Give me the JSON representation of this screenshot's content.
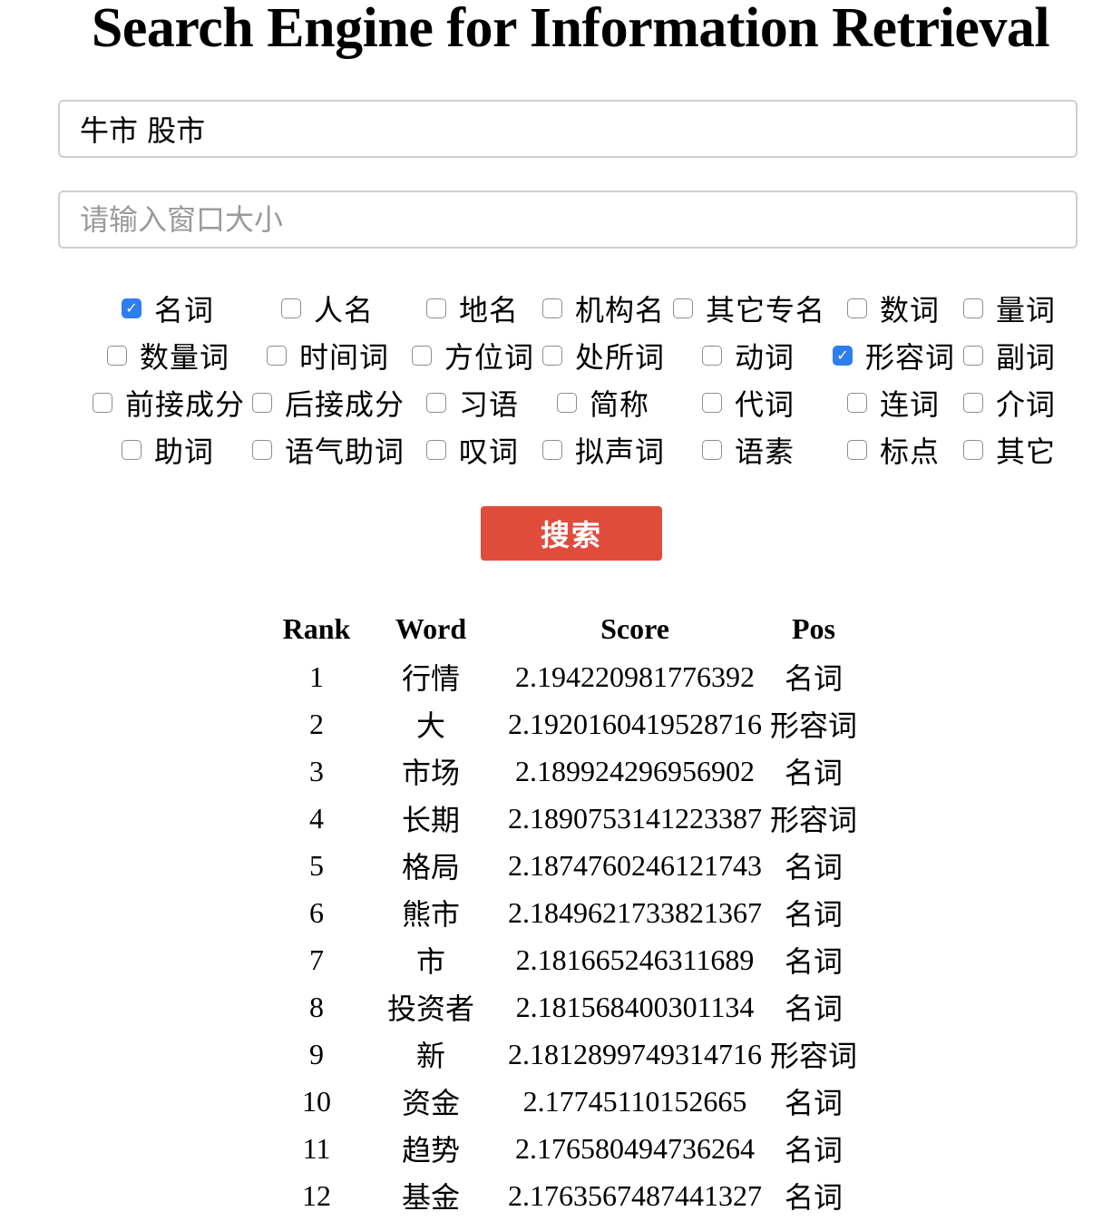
{
  "page_title": "Search Engine for Information Retrieval",
  "query_input": {
    "value": "牛市 股市",
    "placeholder": ""
  },
  "window_input": {
    "value": "",
    "placeholder": "请输入窗口大小"
  },
  "pos_filters": [
    [
      {
        "label": "名词",
        "checked": true
      },
      {
        "label": "人名",
        "checked": false
      },
      {
        "label": "地名",
        "checked": false
      },
      {
        "label": "机构名",
        "checked": false
      },
      {
        "label": "其它专名",
        "checked": false
      },
      {
        "label": "数词",
        "checked": false
      },
      {
        "label": "量词",
        "checked": false
      }
    ],
    [
      {
        "label": "数量词",
        "checked": false
      },
      {
        "label": "时间词",
        "checked": false
      },
      {
        "label": "方位词",
        "checked": false
      },
      {
        "label": "处所词",
        "checked": false
      },
      {
        "label": "动词",
        "checked": false
      },
      {
        "label": "形容词",
        "checked": true
      },
      {
        "label": "副词",
        "checked": false
      }
    ],
    [
      {
        "label": "前接成分",
        "checked": false
      },
      {
        "label": "后接成分",
        "checked": false
      },
      {
        "label": "习语",
        "checked": false
      },
      {
        "label": "简称",
        "checked": false
      },
      {
        "label": "代词",
        "checked": false
      },
      {
        "label": "连词",
        "checked": false
      },
      {
        "label": "介词",
        "checked": false
      }
    ],
    [
      {
        "label": "助词",
        "checked": false
      },
      {
        "label": "语气助词",
        "checked": false
      },
      {
        "label": "叹词",
        "checked": false
      },
      {
        "label": "拟声词",
        "checked": false
      },
      {
        "label": "语素",
        "checked": false
      },
      {
        "label": "标点",
        "checked": false
      },
      {
        "label": "其它",
        "checked": false
      }
    ]
  ],
  "search_button_label": "搜索",
  "results": {
    "headers": {
      "rank": "Rank",
      "word": "Word",
      "score": "Score",
      "pos": "Pos"
    },
    "rows": [
      {
        "rank": "1",
        "word": "行情",
        "score": "2.194220981776392",
        "pos": "名词"
      },
      {
        "rank": "2",
        "word": "大",
        "score": "2.1920160419528716",
        "pos": "形容词"
      },
      {
        "rank": "3",
        "word": "市场",
        "score": "2.189924296956902",
        "pos": "名词"
      },
      {
        "rank": "4",
        "word": "长期",
        "score": "2.1890753141223387",
        "pos": "形容词"
      },
      {
        "rank": "5",
        "word": "格局",
        "score": "2.1874760246121743",
        "pos": "名词"
      },
      {
        "rank": "6",
        "word": "熊市",
        "score": "2.1849621733821367",
        "pos": "名词"
      },
      {
        "rank": "7",
        "word": "市",
        "score": "2.181665246311689",
        "pos": "名词"
      },
      {
        "rank": "8",
        "word": "投资者",
        "score": "2.181568400301134",
        "pos": "名词"
      },
      {
        "rank": "9",
        "word": "新",
        "score": "2.1812899749314716",
        "pos": "形容词"
      },
      {
        "rank": "10",
        "word": "资金",
        "score": "2.17745110152665",
        "pos": "名词"
      },
      {
        "rank": "11",
        "word": "趋势",
        "score": "2.176580494736264",
        "pos": "名词"
      },
      {
        "rank": "12",
        "word": "基金",
        "score": "2.1763567487441327",
        "pos": "名词"
      }
    ]
  },
  "colors": {
    "accent_button": "#e04c3c",
    "checkbox_checked": "#2f7ef0"
  }
}
